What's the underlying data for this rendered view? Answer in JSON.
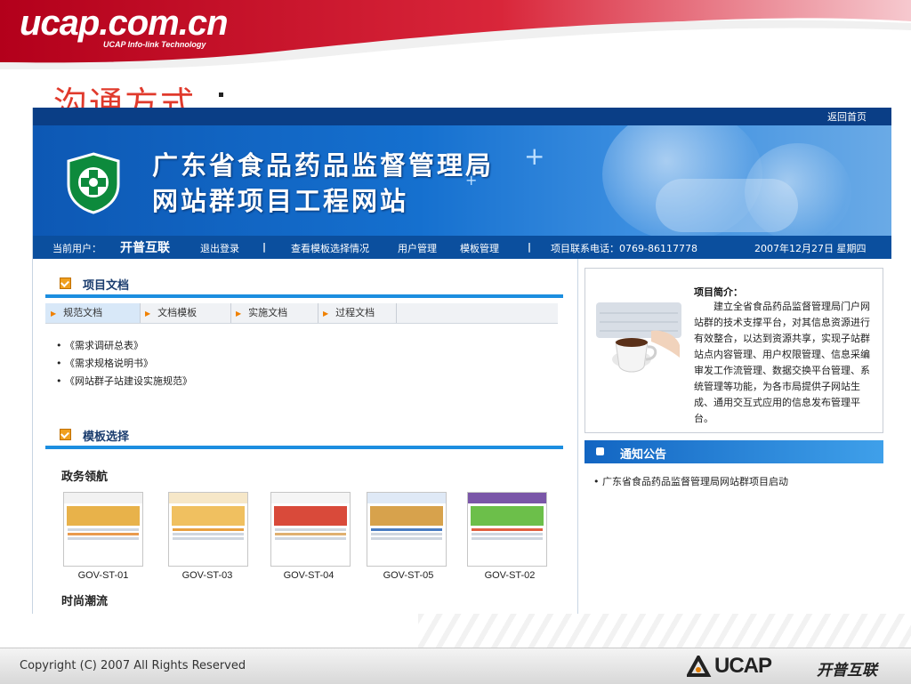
{
  "slide": {
    "brand": "ucap.com.cn",
    "brand_sub": "UCAP Info-link Technology",
    "title": "沟通方式",
    "footer_copyright": "Copyright (C) 2007 All Rights Reserved",
    "footer_logo": "UCAP",
    "footer_logo_cn": "开普互联",
    "colors": {
      "header_red": "#c8102e",
      "title_red": "#e03a2c"
    }
  },
  "site": {
    "back_home": "返回首页",
    "title_line1": "广东省食品药品监督管理局",
    "title_line2": "网站群项目工程网站",
    "nav": {
      "current_user_label": "当前用户：",
      "current_user": "开普互联",
      "logout": "退出登录",
      "sep": "|",
      "view_templates": "查看模板选择情况",
      "user_mgmt": "用户管理",
      "template_mgmt": "模板管理",
      "phone": "项目联系电话：0769-86117778",
      "date": "2007年12月27日 星期四"
    },
    "docs": {
      "title": "项目文档",
      "tabs": [
        "规范文档",
        "文档模板",
        "实施文档",
        "过程文档"
      ],
      "items": [
        "《需求调研总表》",
        "《需求规格说明书》",
        "《网站群子站建设实施规范》"
      ]
    },
    "templates": {
      "title": "模板选择",
      "group1": "政务领航",
      "group2": "时尚潮流",
      "thumbs": [
        "GOV-ST-01",
        "GOV-ST-03",
        "GOV-ST-04",
        "GOV-ST-05",
        "GOV-ST-02"
      ]
    },
    "intro": {
      "title": "项目简介：",
      "text": "建立全省食品药品监督管理局门户网站群的技术支撑平台，对其信息资源进行有效整合，以达到资源共享，实现子站群站点内容管理、用户权限管理、信息采编审发工作流管理、数据交换平台管理、系统管理等功能，为各市局提供子网站生成、通用交互式应用的信息发布管理平台。"
    },
    "notice": {
      "title": "通知公告",
      "items": [
        "广东省食品药品监督管理局网站群项目启动"
      ]
    },
    "colors": {
      "topbar": "#0a3e86",
      "banner": "#1570cf",
      "navbar": "#0b4f9e",
      "accent": "#1c8ee0"
    }
  }
}
